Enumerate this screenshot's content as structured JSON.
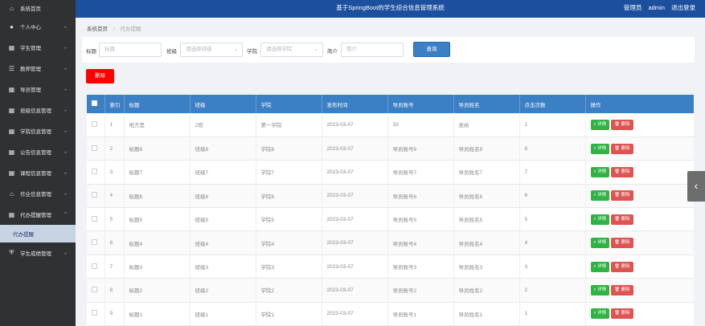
{
  "header": {
    "title": "基于SpringBoot的学生综合信息管理系统",
    "role": "管理员",
    "username": "admin",
    "logout": "退出登录"
  },
  "sidebar": {
    "items": [
      {
        "label": "系统首页",
        "icon": "home-icon"
      },
      {
        "label": "个人中心",
        "icon": "user-icon"
      },
      {
        "label": "学生管理",
        "icon": "grid-icon"
      },
      {
        "label": "教师管理",
        "icon": "sliders-icon"
      },
      {
        "label": "导员管理",
        "icon": "grid-icon"
      },
      {
        "label": "班级信息管理",
        "icon": "grid-icon"
      },
      {
        "label": "学院信息管理",
        "icon": "grid-icon"
      },
      {
        "label": "公告信息管理",
        "icon": "grid-icon"
      },
      {
        "label": "课程信息管理",
        "icon": "grid-icon"
      },
      {
        "label": "作业信息管理",
        "icon": "bank-icon"
      },
      {
        "label": "代办提醒管理",
        "icon": "grid-icon"
      },
      {
        "label": "学生成绩管理",
        "icon": "shield-icon"
      }
    ],
    "active_sub": "代办提醒"
  },
  "breadcrumb": {
    "home": "系统首页",
    "current": "代办提醒"
  },
  "search": {
    "title_label": "标题",
    "title_placeholder": "标题",
    "class_label": "班级",
    "class_placeholder": "请选择班级",
    "college_label": "学院",
    "college_placeholder": "请选择学院",
    "intro_label": "简介",
    "intro_placeholder": "简介",
    "search_button": "查询"
  },
  "delete_button": "删除",
  "table": {
    "headers": [
      "索引",
      "标题",
      "班级",
      "学院",
      "发布时间",
      "导员账号",
      "导员姓名",
      "点击次数",
      "操作"
    ],
    "detail_label": "详情",
    "delete_label": "删除",
    "rows": [
      [
        "1",
        "地方是",
        "2班",
        "第一学院",
        "2023-03-07",
        "33",
        "发给",
        "1"
      ],
      [
        "2",
        "标题8",
        "班级8",
        "学院8",
        "2023-03-07",
        "导员账号8",
        "导员姓名8",
        "8"
      ],
      [
        "3",
        "标题7",
        "班级7",
        "学院7",
        "2023-03-07",
        "导员账号7",
        "导员姓名7",
        "7"
      ],
      [
        "4",
        "标题6",
        "班级6",
        "学院6",
        "2023-03-07",
        "导员账号6",
        "导员姓名6",
        "6"
      ],
      [
        "5",
        "标题5",
        "班级5",
        "学院5",
        "2023-03-07",
        "导员账号5",
        "导员姓名5",
        "5"
      ],
      [
        "6",
        "标题4",
        "班级4",
        "学院4",
        "2023-03-07",
        "导员账号4",
        "导员姓名4",
        "4"
      ],
      [
        "7",
        "标题3",
        "班级3",
        "学院3",
        "2023-03-07",
        "导员账号3",
        "导员姓名3",
        "3"
      ],
      [
        "8",
        "标题2",
        "班级2",
        "学院2",
        "2023-03-07",
        "导员账号2",
        "导员姓名2",
        "2"
      ],
      [
        "9",
        "标题1",
        "班级1",
        "学院1",
        "2023-03-07",
        "导员账号1",
        "导员姓名1",
        "1"
      ]
    ]
  }
}
